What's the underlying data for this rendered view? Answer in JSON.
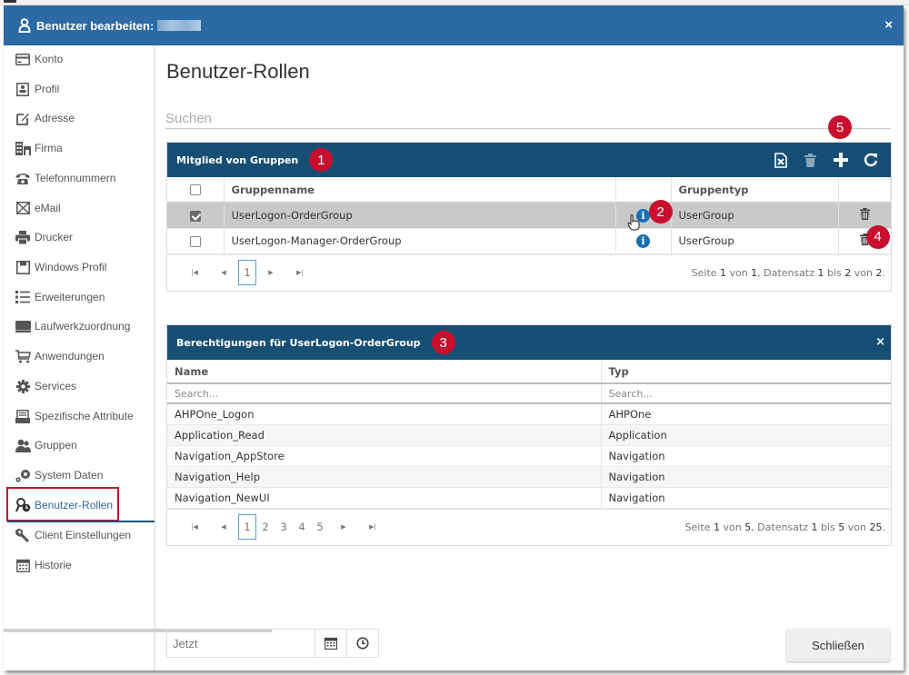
{
  "dialog": {
    "title": "Benutzer bearbeiten:",
    "close_label": "×",
    "user_icon": "user-icon"
  },
  "sidebar": {
    "items": [
      {
        "label": "Konto",
        "icon": "credit-card-icon"
      },
      {
        "label": "Profil",
        "icon": "profile-card-icon"
      },
      {
        "label": "Adresse",
        "icon": "edit-icon"
      },
      {
        "label": "Firma",
        "icon": "building-icon"
      },
      {
        "label": "Telefonnummern",
        "icon": "phone-icon"
      },
      {
        "label": "eMail",
        "icon": "envelope-icon"
      },
      {
        "label": "Drucker",
        "icon": "printer-icon"
      },
      {
        "label": "Windows Profil",
        "icon": "floppy-disk-icon"
      },
      {
        "label": "Erweiterungen",
        "icon": "list-icon"
      },
      {
        "label": "Laufwerkzuordnung",
        "icon": "drive-icon"
      },
      {
        "label": "Anwendungen",
        "icon": "cart-icon"
      },
      {
        "label": "Services",
        "icon": "gear-icon"
      },
      {
        "label": "Spezifische Attribute",
        "icon": "archive-icon"
      },
      {
        "label": "Gruppen",
        "icon": "users-icon"
      },
      {
        "label": "System Daten",
        "icon": "cogs-icon"
      },
      {
        "label": "Benutzer-Rollen",
        "icon": "key-clock-icon",
        "active": true
      },
      {
        "label": "Client Einstellungen",
        "icon": "wrench-icon"
      },
      {
        "label": "Historie",
        "icon": "calendar-icon"
      }
    ]
  },
  "main": {
    "title": "Benutzer-Rollen",
    "search_placeholder": "Suchen"
  },
  "groups_panel": {
    "title": "Mitglied von Gruppen",
    "badge": "1",
    "tools_badge": "5",
    "tools": [
      "excel-export-icon",
      "trash-icon",
      "plus-icon",
      "refresh-icon"
    ],
    "columns": [
      "",
      "Gruppenname",
      "",
      "Gruppentyp",
      ""
    ],
    "rows": [
      {
        "checked": true,
        "name": "UserLogon-OrderGroup",
        "type": "UserGroup",
        "selected": true
      },
      {
        "checked": false,
        "name": "UserLogon-Manager-OrderGroup",
        "type": "UserGroup",
        "selected": false
      }
    ],
    "info_badge": "2",
    "delete_badge": "4",
    "pager": {
      "pages": [
        "1"
      ],
      "current": "1",
      "info": {
        "seite": "Seite",
        "page": "1",
        "von1": "von",
        "pages_total": "1",
        "datensatz": ", Datensatz",
        "from": "1",
        "bis": "bis",
        "to": "2",
        "von2": "von",
        "total": "2",
        "end": "."
      }
    }
  },
  "perm_panel": {
    "title": "Berechtigungen für UserLogon-OrderGroup",
    "badge": "3",
    "close_label": "×",
    "columns": [
      "Name",
      "Typ"
    ],
    "search_placeholder": "Search...",
    "rows": [
      {
        "name": "AHPOne_Logon",
        "type": "AHPOne"
      },
      {
        "name": "Application_Read",
        "type": "Application"
      },
      {
        "name": "Navigation_AppStore",
        "type": "Navigation"
      },
      {
        "name": "Navigation_Help",
        "type": "Navigation"
      },
      {
        "name": "Navigation_NewUI",
        "type": "Navigation"
      }
    ],
    "pager": {
      "pages": [
        "1",
        "2",
        "3",
        "4",
        "5"
      ],
      "current": "1",
      "info": {
        "seite": "Seite",
        "page": "1",
        "von1": "von",
        "pages_total": "5",
        "datensatz": ", Datensatz",
        "from": "1",
        "bis": "bis",
        "to": "5",
        "von2": "von",
        "total": "25",
        "end": "."
      }
    }
  },
  "footer": {
    "date_placeholder": "Jetzt",
    "close_button": "Schließen"
  },
  "colors": {
    "titlebar": "#2c6aa3",
    "panel_header": "#164f73",
    "badge": "#c8102e",
    "active_nav": "#2c6aa3"
  }
}
